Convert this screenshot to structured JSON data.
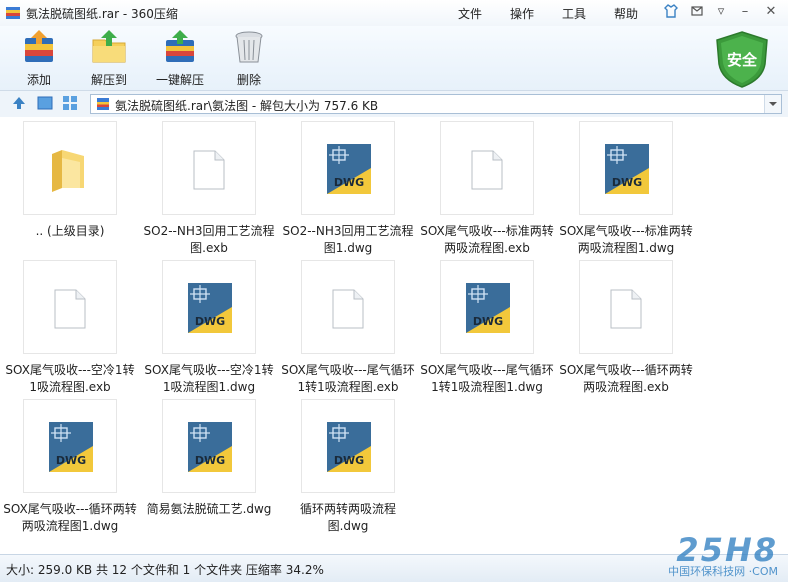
{
  "window": {
    "title": "氨法脱硫图纸.rar - 360压缩",
    "menu": [
      "文件",
      "操作",
      "工具",
      "帮助"
    ]
  },
  "toolbar": {
    "buttons": [
      {
        "label": "添加",
        "icon": "add-archive-icon"
      },
      {
        "label": "解压到",
        "icon": "extract-to-icon"
      },
      {
        "label": "一键解压",
        "icon": "one-click-extract-icon"
      },
      {
        "label": "删除",
        "icon": "trash-icon"
      }
    ],
    "security_label": "安全"
  },
  "address": {
    "path": "氨法脱硫图纸.rar\\氨法图 - 解包大小为 757.6 KB"
  },
  "files": [
    {
      "name": ".. (上级目录)",
      "type": "folder"
    },
    {
      "name": "SO2--NH3回用工艺流程图.exb",
      "type": "exb"
    },
    {
      "name": "SO2--NH3回用工艺流程图1.dwg",
      "type": "dwg"
    },
    {
      "name": "SOX尾气吸收---标准两转两吸流程图.exb",
      "type": "exb"
    },
    {
      "name": "SOX尾气吸收---标准两转两吸流程图1.dwg",
      "type": "dwg"
    },
    {
      "name": "SOX尾气吸收---空冷1转1吸流程图.exb",
      "type": "exb"
    },
    {
      "name": "SOX尾气吸收---空冷1转1吸流程图1.dwg",
      "type": "dwg"
    },
    {
      "name": "SOX尾气吸收---尾气循环1转1吸流程图.exb",
      "type": "exb"
    },
    {
      "name": "SOX尾气吸收---尾气循环1转1吸流程图1.dwg",
      "type": "dwg"
    },
    {
      "name": "SOX尾气吸收---循环两转两吸流程图.exb",
      "type": "exb"
    },
    {
      "name": "SOX尾气吸收---循环两转两吸流程图1.dwg",
      "type": "dwg"
    },
    {
      "name": "简易氨法脱硫工艺.dwg",
      "type": "dwg"
    },
    {
      "name": "循环两转两吸流程图.dwg",
      "type": "dwg"
    }
  ],
  "dwg_badge": "DWG",
  "status": {
    "text": "大小: 259.0 KB 共 12 个文件和 1 个文件夹 压缩率 34.2%"
  },
  "watermark": {
    "logo": "25H8",
    "site": "中国环保科技网 ·COM"
  }
}
